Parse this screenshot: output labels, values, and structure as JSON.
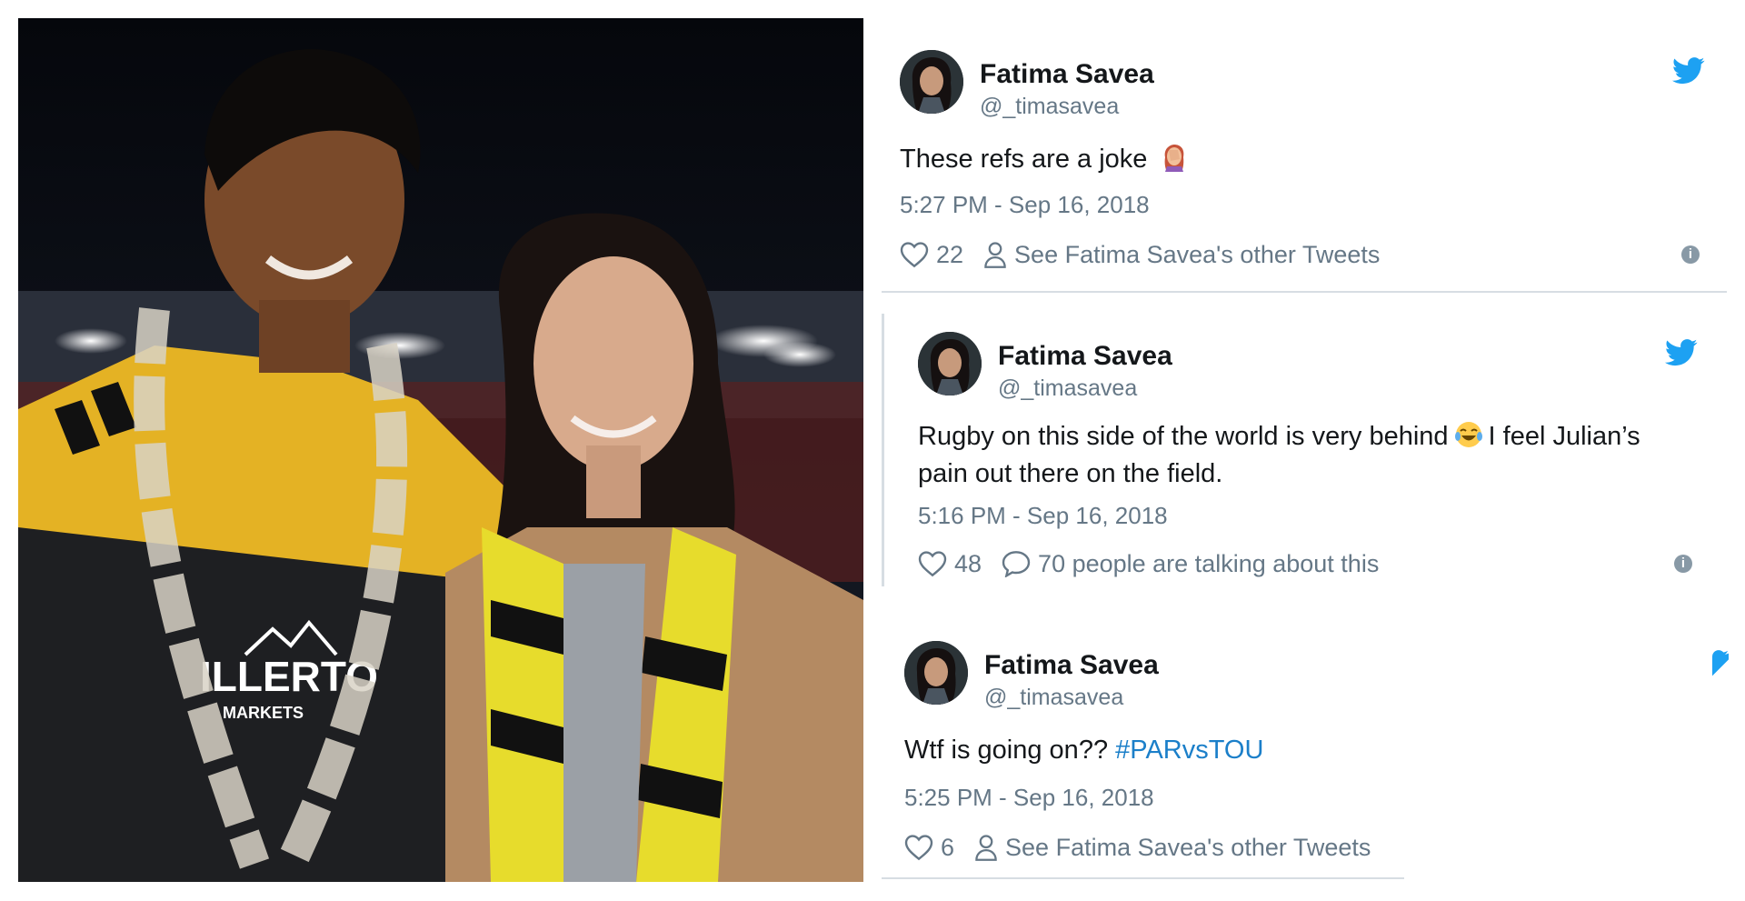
{
  "colors": {
    "twitter_blue": "#1da1f2",
    "hashtag_blue": "#1b7fc9",
    "muted_text": "#657786",
    "primary_text": "#14171a"
  },
  "photo": {
    "icon": "rugby-couple-photo",
    "jersey_sponsor_text": "ILLERTO",
    "jersey_sub_text": "MARKETS"
  },
  "tweets": [
    {
      "name": "Fatima Savea",
      "handle": "@_timasavea",
      "text": "These refs are a joke",
      "emoji": "woman-facepalming-emoji",
      "time": "5:27 PM - Sep 16, 2018",
      "likes": "22",
      "secondary_action": "See Fatima Savea's other Tweets",
      "secondary_icon": "person-icon"
    },
    {
      "name": "Fatima Savea",
      "handle": "@_timasavea",
      "text_line1": "Rugby on this side of the world is very behind",
      "emoji": "tears-of-joy-emoji",
      "text_line1_after": "I feel Julian’s",
      "text_line2": "pain out there on the field.",
      "time": "5:16 PM - Sep 16, 2018",
      "likes": "48",
      "secondary_action": "70 people are talking about this",
      "secondary_icon": "speech-bubble-icon"
    },
    {
      "name": "Fatima Savea",
      "handle": "@_timasavea",
      "text": "Wtf is going on??",
      "hashtag": "#PARvsTOU",
      "time": "5:25 PM - Sep 16, 2018",
      "likes": "6",
      "secondary_action": "See Fatima Savea's other Tweets",
      "secondary_icon": "person-icon"
    }
  ]
}
